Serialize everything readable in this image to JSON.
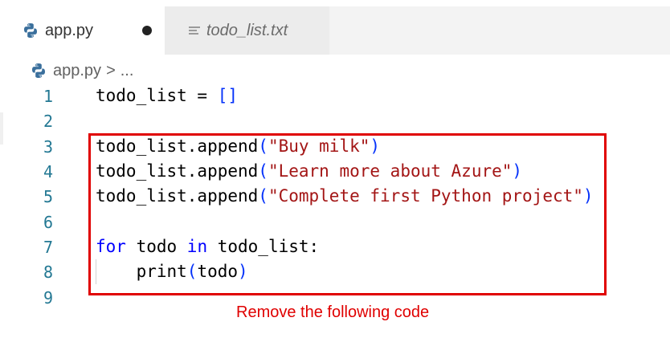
{
  "tabs": [
    {
      "label": "app.py",
      "icon": "python-icon",
      "dirty": true
    },
    {
      "label": "todo_list.txt",
      "icon": "text-file-icon"
    }
  ],
  "breadcrumb": {
    "file": "app.py",
    "separator": ">",
    "more": "..."
  },
  "code_lines": [
    {
      "num": "1",
      "text": "todo_list = []"
    },
    {
      "num": "2",
      "text": ""
    },
    {
      "num": "3",
      "text": "todo_list.append(\"Buy milk\")"
    },
    {
      "num": "4",
      "text": "todo_list.append(\"Learn more about Azure\")"
    },
    {
      "num": "5",
      "text": "todo_list.append(\"Complete first Python project\")"
    },
    {
      "num": "6",
      "text": ""
    },
    {
      "num": "7",
      "text": "for todo in todo_list:"
    },
    {
      "num": "8",
      "text": "    print(todo)"
    },
    {
      "num": "9",
      "text": ""
    }
  ],
  "annotation": {
    "text": "Remove the following code",
    "color": "#e00000"
  },
  "colors": {
    "keyword": "#0000ff",
    "string": "#a31515",
    "line_number": "#237893",
    "bracket": "#0431fa"
  }
}
